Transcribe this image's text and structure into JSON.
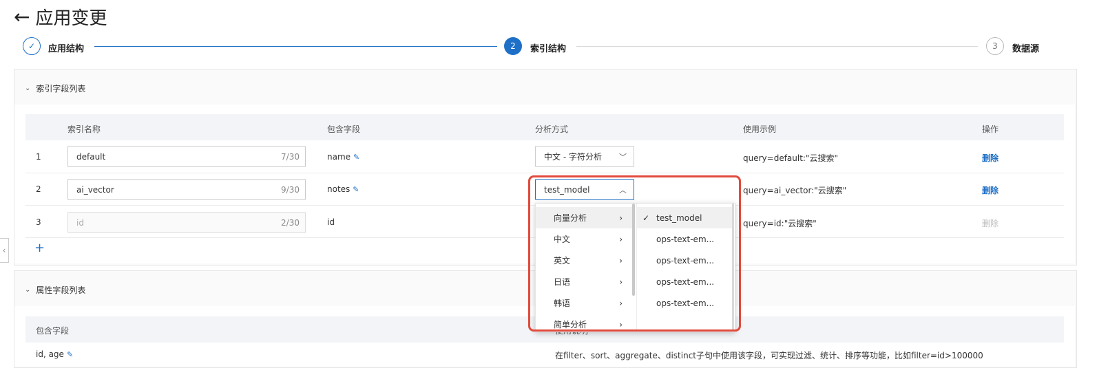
{
  "header": {
    "back_icon": "arrow-left-icon",
    "title": "应用变更"
  },
  "steps": [
    {
      "index": "1",
      "label": "应用结构",
      "state": "done"
    },
    {
      "index": "2",
      "label": "索引结构",
      "state": "active"
    },
    {
      "index": "3",
      "label": "数据源",
      "state": "wait"
    }
  ],
  "colors": {
    "primary": "#1e6fc7",
    "highlight": "#e24a3b",
    "line_inactive": "#d9d9d9"
  },
  "index_panel": {
    "title": "索引字段列表",
    "columns": [
      "索引名称",
      "包含字段",
      "分析方式",
      "使用示例",
      "操作"
    ],
    "rows": [
      {
        "num": "1",
        "name": "default",
        "count": "7/30",
        "field": "name",
        "analysis": "中文 - 字符分析",
        "example": "query=default:\"云搜索\"",
        "action": "删除"
      },
      {
        "num": "2",
        "name": "ai_vector",
        "count": "9/30",
        "field": "notes",
        "analysis": "test_model",
        "example": "query=ai_vector:\"云搜索\"",
        "action": "删除"
      },
      {
        "num": "3",
        "name": "id",
        "count": "2/30",
        "field": "id",
        "analysis": "",
        "example": "query=id:\"云搜索\"",
        "action": "删除"
      }
    ],
    "add_label": "+"
  },
  "attr_panel": {
    "title": "属性字段列表",
    "col_field": "包含字段",
    "col_desc": "使用说明",
    "first_row_field": "id, age",
    "first_row_desc": "在filter、sort、aggregate、distinct子句中使用该字段，可实现过滤、统计、排序等功能，比如filter=id>100000"
  },
  "dropdown": {
    "categories": [
      "向量分析",
      "中文",
      "英文",
      "日语",
      "韩语",
      "简单分析"
    ],
    "models": [
      "test_model",
      "ops-text-em...",
      "ops-text-em...",
      "ops-text-em...",
      "ops-text-em..."
    ]
  }
}
